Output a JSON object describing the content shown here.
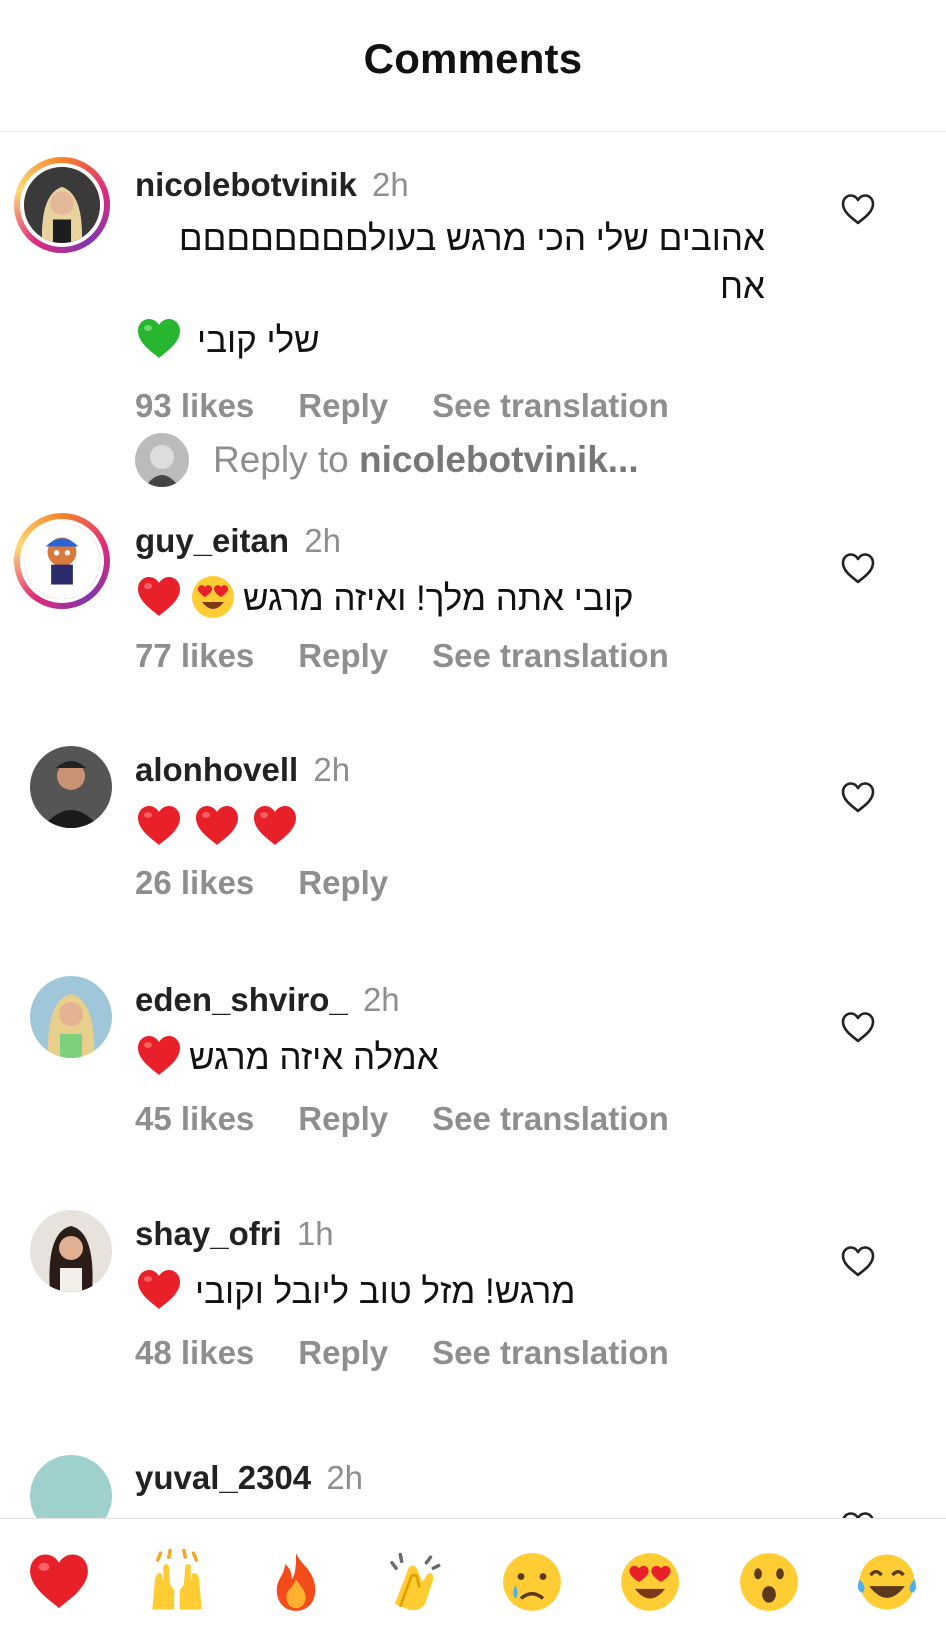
{
  "header": {
    "title": "Comments"
  },
  "comments": [
    {
      "username": "nicolebotvinik",
      "time": "2h",
      "text_line1": "אהובים שלי הכי מרגש בעולםםםםםםםם אח",
      "text_line2": "שלי קובי",
      "emojis": [
        "green-heart"
      ],
      "likes": "93 likes",
      "reply": "Reply",
      "translate": "See translation"
    },
    {
      "username": "guy_eitan",
      "time": "2h",
      "text_line1": "קובי אתה מלך! ואיזה מרגש",
      "emojis": [
        "red-heart",
        "heart-eyes"
      ],
      "likes": "77 likes",
      "reply": "Reply",
      "translate": "See translation"
    },
    {
      "username": "alonhovell",
      "time": "2h",
      "emojis": [
        "red-heart",
        "red-heart",
        "red-heart"
      ],
      "likes": "26 likes",
      "reply": "Reply"
    },
    {
      "username": "eden_shviro_",
      "time": "2h",
      "text_line1": "אמלה איזה מרגש",
      "emojis": [
        "red-heart"
      ],
      "likes": "45 likes",
      "reply": "Reply",
      "translate": "See translation"
    },
    {
      "username": "shay_ofri",
      "time": "1h",
      "text_line1": "מרגש! מזל טוב ליובל וקובי",
      "emojis": [
        "red-heart"
      ],
      "likes": "48 likes",
      "reply": "Reply",
      "translate": "See translation"
    },
    {
      "username": "yuval_2304",
      "time": "2h"
    }
  ],
  "reply_input": {
    "prefix": "Reply to ",
    "target": "nicolebotvinik..."
  },
  "quick_reactions": [
    "red-heart",
    "raising-hands",
    "fire",
    "clapping-hands",
    "crying-face",
    "heart-eyes",
    "surprised-face",
    "tears-of-joy"
  ],
  "colors": {
    "secondary_text": "#8e8e8e",
    "story_ring_start": "#f58529",
    "story_ring_mid": "#dd2a7b"
  }
}
